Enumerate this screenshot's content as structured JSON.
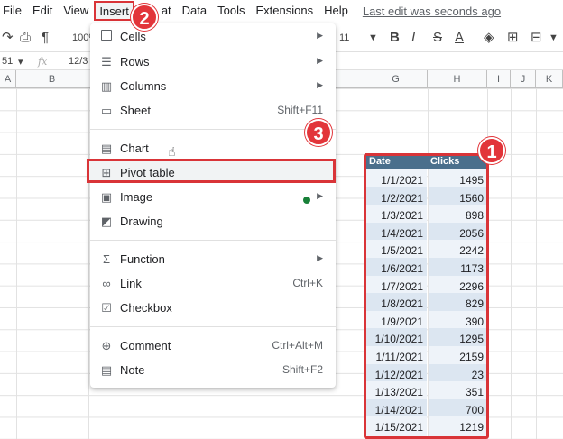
{
  "menubar": {
    "items": [
      "File",
      "Edit",
      "View",
      "Insert",
      "Format",
      "Data",
      "Tools",
      "Extensions",
      "Help"
    ],
    "insert_visible": "Insert",
    "format_partial": "at",
    "last_edit": "Last edit was seconds ago"
  },
  "toolbar": {
    "zoom": "100%",
    "font_size": "11",
    "bold": "B",
    "italic": "I",
    "strike": "S",
    "text_color": "A"
  },
  "formula_bar": {
    "cell_ref": "51",
    "fx": "fx",
    "content": "12/3"
  },
  "columns": [
    "A",
    "B",
    "G",
    "H",
    "I",
    "J",
    "K"
  ],
  "insert_menu": {
    "items": [
      {
        "label": "Cells",
        "icon": "cells-icon",
        "submenu": true
      },
      {
        "label": "Rows",
        "icon": "rows-icon",
        "submenu": true
      },
      {
        "label": "Columns",
        "icon": "columns-icon",
        "submenu": true
      },
      {
        "label": "Sheet",
        "icon": "sheet-icon",
        "shortcut": "Shift+F11"
      },
      {
        "label": "Chart",
        "icon": "chart-icon"
      },
      {
        "label": "Pivot table",
        "icon": "pivot-table-icon"
      },
      {
        "label": "Image",
        "icon": "image-icon",
        "submenu": true
      },
      {
        "label": "Drawing",
        "icon": "drawing-icon"
      },
      {
        "label": "Function",
        "icon": "sigma-icon",
        "submenu": true
      },
      {
        "label": "Link",
        "icon": "link-icon",
        "shortcut": "Ctrl+K"
      },
      {
        "label": "Checkbox",
        "icon": "checkbox-icon"
      },
      {
        "label": "Comment",
        "icon": "comment-icon",
        "shortcut": "Ctrl+Alt+M"
      },
      {
        "label": "Note",
        "icon": "note-icon",
        "shortcut": "Shift+F2"
      }
    ]
  },
  "badges": [
    "1",
    "2",
    "3"
  ],
  "table": {
    "headers": [
      "Date",
      "Clicks"
    ],
    "rows": [
      [
        "1/1/2021",
        "1495"
      ],
      [
        "1/2/2021",
        "1560"
      ],
      [
        "1/3/2021",
        "898"
      ],
      [
        "1/4/2021",
        "2056"
      ],
      [
        "1/5/2021",
        "2242"
      ],
      [
        "1/6/2021",
        "1173"
      ],
      [
        "1/7/2021",
        "2296"
      ],
      [
        "1/8/2021",
        "829"
      ],
      [
        "1/9/2021",
        "390"
      ],
      [
        "1/10/2021",
        "1295"
      ],
      [
        "1/11/2021",
        "2159"
      ],
      [
        "1/12/2021",
        "23"
      ],
      [
        "1/13/2021",
        "351"
      ],
      [
        "1/14/2021",
        "700"
      ],
      [
        "1/15/2021",
        "1219"
      ]
    ]
  },
  "colors": {
    "highlight_red": "#d93438",
    "header_blue": "#4a6f8c",
    "row_alt": "#dce6f1",
    "row_plain": "#eef3f9",
    "image_dot": "#188038"
  }
}
